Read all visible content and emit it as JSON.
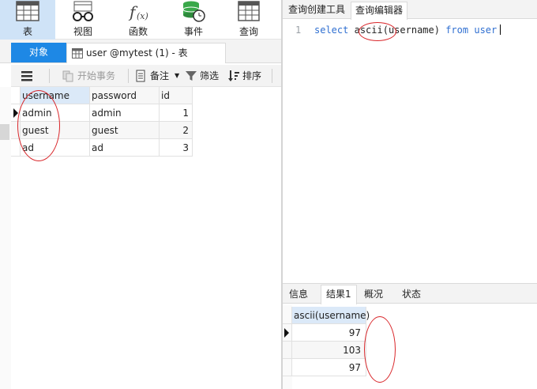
{
  "ribbon": {
    "buttons": [
      {
        "label": "表",
        "icon": "table-icon",
        "active": true
      },
      {
        "label": "视图",
        "icon": "glasses-icon",
        "active": false
      },
      {
        "label": "函数",
        "icon": "function-icon",
        "active": false
      },
      {
        "label": "事件",
        "icon": "event-clock-icon",
        "active": false
      },
      {
        "label": "查询",
        "icon": "query-grid-icon",
        "active": false
      }
    ]
  },
  "tabs": {
    "object_tab": "对象",
    "document_tab": "user @mytest (1) - 表"
  },
  "toolbar": {
    "begin_transaction": "开始事务",
    "note": "备注",
    "filter": "筛选",
    "sort": "排序"
  },
  "grid": {
    "columns": [
      "username",
      "password",
      "id"
    ],
    "rows": [
      [
        "admin",
        "admin",
        "1"
      ],
      [
        "guest",
        "guest",
        "2"
      ],
      [
        "ad",
        "ad",
        "3"
      ]
    ]
  },
  "right": {
    "tabs": [
      "查询创建工具",
      "查询编辑器"
    ],
    "editor": {
      "line_number": "1",
      "kw_select": "select",
      "fn_ascii": "ascii",
      "arg": "(username)",
      "kw_from": "from",
      "table_name": "user"
    },
    "result_tabs": [
      "信息",
      "结果1",
      "概况",
      "状态"
    ],
    "result": {
      "column": "ascii(username)",
      "values": [
        "97",
        "103",
        "97"
      ]
    }
  },
  "colors": {
    "accent": "#1e88e5",
    "keyword": "#2f6fd1",
    "annotation": "#d9262a",
    "selected_header": "#dbe9f8"
  }
}
